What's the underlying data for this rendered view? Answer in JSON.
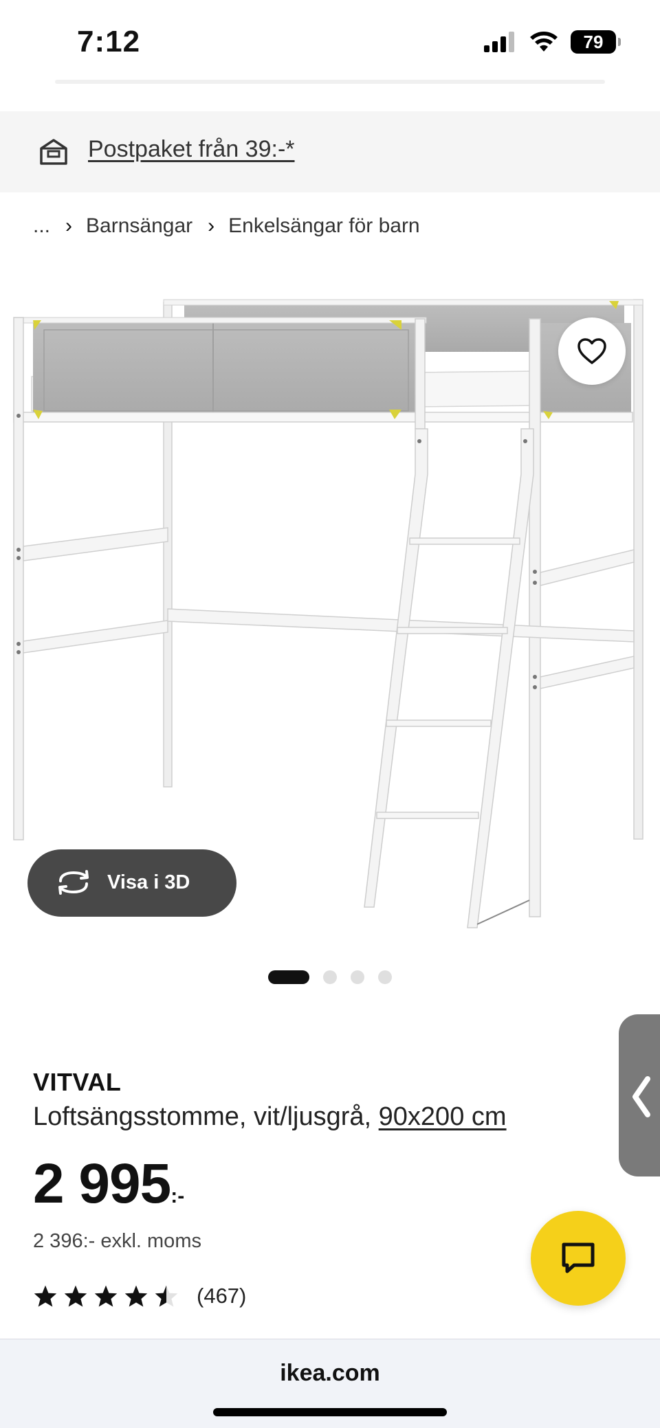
{
  "status_bar": {
    "time": "7:12",
    "battery": "79"
  },
  "promo": {
    "text": "Postpaket från 39:-*",
    "icon": "package-delivery-icon"
  },
  "breadcrumb": {
    "ellipsis": "...",
    "items": [
      "Barnsängar",
      "Enkelsängar för barn"
    ]
  },
  "gallery": {
    "image": "loft-bed-white-light-grey",
    "view_3d_label": "Visa i 3D",
    "total_images": 4,
    "active_index": 0
  },
  "product": {
    "name": "VITVAL",
    "description": "Loftsängsstomme, vit/ljusgrå,",
    "size": "90x200 cm",
    "price": "2 995",
    "price_suffix": ":-",
    "price_excl_vat": "2 396:- exkl. moms",
    "rating_value": 4.5,
    "rating_max": 5,
    "rating_count": "(467)"
  },
  "colors": {
    "accent_yellow": "#F5D01A",
    "view3d_bg": "#484848",
    "frame_grey": "#B9B9B9"
  },
  "browser": {
    "url": "ikea.com"
  }
}
